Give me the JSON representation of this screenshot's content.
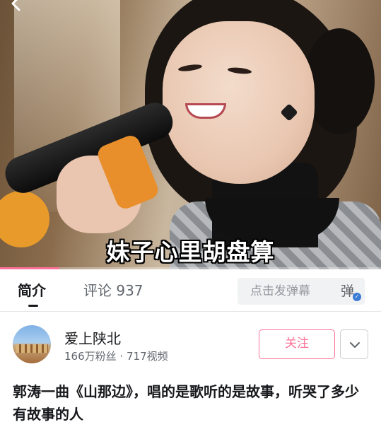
{
  "video": {
    "subtitle": "妹子心里胡盘算",
    "progress_fraction": 0.155
  },
  "tabs": {
    "intro_label": "简介",
    "comments_label": "评论 937"
  },
  "danmaku": {
    "placeholder": "点击发弹幕",
    "toggle_label": "弹"
  },
  "uploader": {
    "name": "爱上陕北",
    "followers": "166万粉丝",
    "separator": "·",
    "videos": "717视频",
    "follow_label": "关注"
  },
  "title": {
    "text": "郭涛一曲《山那边》，唱的是歌听的是故事，听哭了多少有故事的人"
  },
  "colors": {
    "accent": "#fb7299",
    "text_primary": "#18191c",
    "text_secondary": "#61666d"
  },
  "icons": {
    "back": "chevron-left-icon",
    "more": "chevron-down-icon",
    "danmaku_toggle": "danmaku-toggle-icon"
  }
}
